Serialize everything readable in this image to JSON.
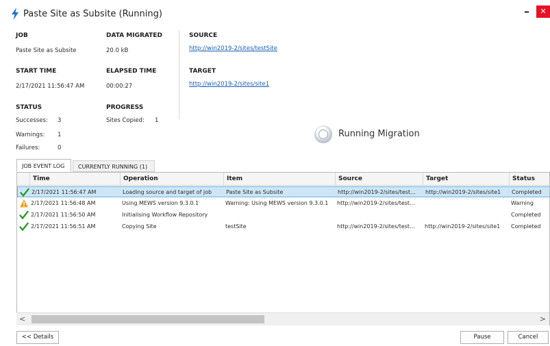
{
  "window": {
    "title": "Paste Site as Subsite (Running)",
    "minimize_label": "–",
    "close_label": "✕"
  },
  "summary": {
    "job_label": "JOB",
    "job_value": "Paste Site as Subsite",
    "data_migrated_label": "DATA MIGRATED",
    "data_migrated_value": "20.0 kB",
    "source_label": "SOURCE",
    "source_url": "http://win2019-2/sites/testSite",
    "start_time_label": "START TIME",
    "start_time_value": "2/17/2021 11:56:47 AM",
    "elapsed_time_label": "ELAPSED TIME",
    "elapsed_time_value": "00:00:27",
    "target_label": "TARGET",
    "target_url": "http://win2019-2/sites/site1",
    "status_label": "STATUS",
    "successes_label": "Successes:",
    "successes_value": "3",
    "warnings_label": "Warnings:",
    "warnings_value": "1",
    "failures_label": "Failures:",
    "failures_value": "0",
    "progress_label": "PROGRESS",
    "sites_copied_label": "Sites Copied:",
    "sites_copied_value": "1"
  },
  "running_status": "Running Migration",
  "tabs": [
    {
      "label": "JOB EVENT LOG",
      "active": true
    },
    {
      "label": "CURRENTLY RUNNING (1)",
      "active": false
    }
  ],
  "grid": {
    "columns": [
      "Time",
      "Operation",
      "Item",
      "Source",
      "Target",
      "Status"
    ],
    "rows": [
      {
        "icon": "success-check-icon",
        "time": "2/17/2021 11:56:47 AM",
        "operation": "Loading source and target of job",
        "item": "Paste Site as Subsite",
        "source": "http://win2019-2/sites/test…",
        "target": "http://win2019-2/sites/site1",
        "status": "Completed",
        "selected": true
      },
      {
        "icon": "warning-triangle-icon",
        "time": "2/17/2021 11:56:48 AM",
        "operation": "Using MEWS version 9.3.0.1",
        "item": "Warning: Using MEWS version 9.3.0.1",
        "source": "http://win2019-2/sites/test…",
        "target": "",
        "status": "Warning",
        "selected": false
      },
      {
        "icon": "success-check-icon",
        "time": "2/17/2021 11:56:50 AM",
        "operation": "Initialising Workflow Repository",
        "item": "",
        "source": "",
        "target": "",
        "status": "Completed",
        "selected": false
      },
      {
        "icon": "success-check-icon",
        "time": "2/17/2021 11:56:51 AM",
        "operation": "Copying Site",
        "item": "testSite",
        "source": "http://win2019-2/sites/test…",
        "target": "http://win2019-2/sites/site1",
        "status": "Completed",
        "selected": false
      }
    ]
  },
  "scrollbar": {
    "left_arrow": "<",
    "right_arrow": ">"
  },
  "buttons": {
    "details": "<< Details",
    "pause": "Pause",
    "cancel": "Cancel"
  },
  "colors": {
    "success": "#2e9b2e",
    "warning": "#f0a020",
    "accent_link": "#1a5fb4",
    "lightning": "#1e6fd0",
    "close": "#e81123"
  }
}
